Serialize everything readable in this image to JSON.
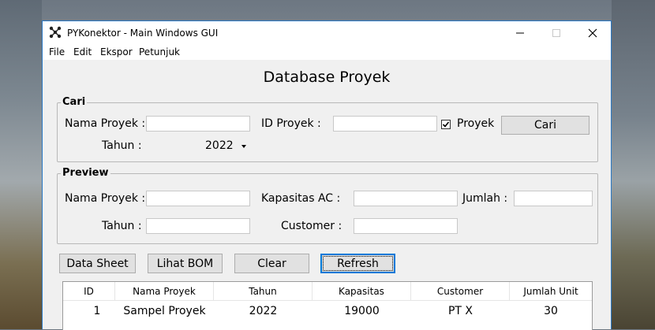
{
  "window": {
    "title": "PYKonektor - Main Windows GUI"
  },
  "menu": [
    "File",
    "Edit",
    "Ekspor",
    "Petunjuk"
  ],
  "heading": "Database Proyek",
  "cari": {
    "title": "Cari",
    "nama_label": "Nama Proyek :",
    "nama_value": "",
    "id_label": "ID Proyek :",
    "id_value": "",
    "checkbox_label": "Proyek",
    "checkbox_checked": true,
    "tahun_label": "Tahun :",
    "tahun_value": "2022",
    "button": "Cari"
  },
  "preview": {
    "title": "Preview",
    "nama_label": "Nama Proyek :",
    "kapasitas_label": "Kapasitas AC :",
    "jumlah_label": "Jumlah :",
    "tahun_label": "Tahun :",
    "customer_label": "Customer :"
  },
  "buttons": {
    "datasheet": "Data Sheet",
    "bom": "Lihat BOM",
    "clear": "Clear",
    "refresh": "Refresh"
  },
  "table": {
    "columns": [
      "ID",
      "Nama Proyek",
      "Tahun",
      "Kapasitas",
      "Customer",
      "Jumlah Unit"
    ],
    "rows": [
      [
        "1",
        "Sampel Proyek",
        "2022",
        "19000",
        "PT X",
        "30"
      ]
    ]
  },
  "colors": {
    "accent": "#0078d7",
    "window_border": "#2b79c5"
  }
}
